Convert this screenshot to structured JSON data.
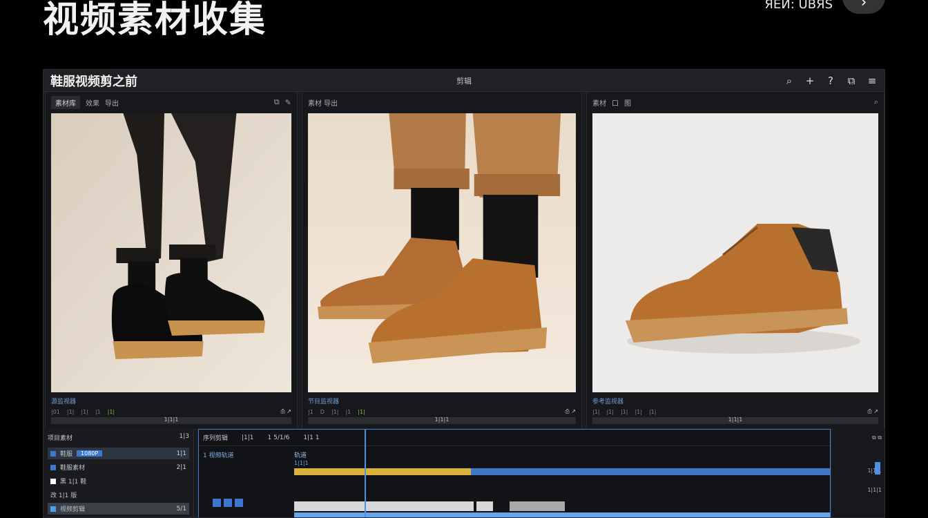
{
  "page": {
    "title": "视频素材收集",
    "top_meta": "ЯЕЙ: UBЯS",
    "next_icon": "chevron-right-icon"
  },
  "app": {
    "title": "鞋服视频剪之前",
    "menu": "剪辑",
    "toolbar_icons": [
      "search-icon",
      "plus-icon",
      "help-icon",
      "window-icon",
      "menu-icon"
    ]
  },
  "viewers": [
    {
      "head": [
        "素材库",
        "效果",
        "导出"
      ],
      "foot": "源监视器",
      "ctrl": [
        "|01",
        "|1|",
        "|1|",
        "|1",
        "|1|",
        "|1|"
      ],
      "scrub": "1|1|1"
    },
    {
      "head": [
        "素材 导出",
        "",
        ""
      ],
      "foot": "节目监视器",
      "ctrl": [
        "|1",
        "D",
        "|1|",
        "|1",
        "|1|",
        "|1"
      ],
      "scrub": "1|1|1"
    },
    {
      "head": [
        "素材",
        "口",
        "图"
      ],
      "foot": "参考监视器",
      "ctrl": [
        "|1|",
        "|1|",
        "|1|",
        "|1|",
        "|1|",
        "|1"
      ],
      "scrub": "1|1|1"
    }
  ],
  "bin": {
    "title": "项目素材",
    "count": "1|3",
    "rows": [
      {
        "label": "鞋服",
        "val": "1|1",
        "tag": "1080P"
      },
      {
        "label": "鞋服素材",
        "val": "2|1",
        "tag": ""
      },
      {
        "label": "黑 1|1 鞋",
        "val": "",
        "tag": ""
      },
      {
        "label": "改 1|1 版",
        "val": "",
        "tag": ""
      },
      {
        "label": "视频剪辑",
        "val": "5/1",
        "tag": ""
      }
    ]
  },
  "timeline": {
    "title": "序列剪辑",
    "tc1": "|1|1",
    "tc2": "1 5/1/6",
    "tc3": "1|1 1",
    "track_label": "1 视频轨道",
    "track_name": "轨道",
    "ruler": "1|1|1"
  },
  "rail": {
    "items": [
      "1|1|1",
      "1|1|1"
    ]
  },
  "colors": {
    "accent": "#3b78d0",
    "clip_yellow": "#d8b23a",
    "clip_blue": "#3f78c6",
    "green": "#7fc050"
  }
}
